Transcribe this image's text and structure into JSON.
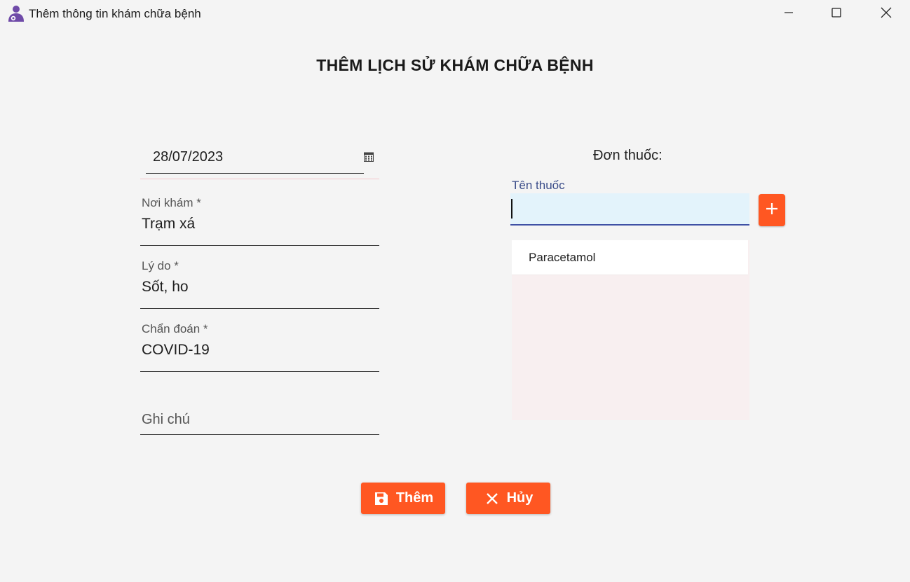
{
  "window": {
    "title": "Thêm thông tin khám chữa bệnh",
    "icon": "user-medical-icon",
    "controls": [
      "minimize-icon",
      "maximize-icon",
      "close-icon"
    ]
  },
  "page": {
    "title": "THÊM LỊCH SỬ KHÁM CHỮA BỆNH"
  },
  "form": {
    "date": {
      "value": "28/07/2023",
      "icon": "calendar-icon"
    },
    "place": {
      "label": "Nơi khám *",
      "value": "Trạm xá"
    },
    "reason": {
      "label": "Lý do *",
      "value": "Sốt, ho"
    },
    "diagnosis": {
      "label": "Chẩn đoán *",
      "value": "COVID-19"
    },
    "note": {
      "placeholder": "Ghi chú",
      "value": ""
    }
  },
  "prescription": {
    "heading": "Đơn thuốc:",
    "drug_input": {
      "label": "Tên thuốc",
      "value": ""
    },
    "add_icon": "plus-icon",
    "drugs": [
      "Paracetamol"
    ]
  },
  "actions": {
    "save": {
      "label": "Thêm",
      "icon": "save-icon"
    },
    "cancel": {
      "label": "Hủy",
      "icon": "close-icon"
    }
  },
  "colors": {
    "accent": "#ff5722",
    "input_focus": "#3f51a5",
    "input_bg": "#e3f3fb",
    "background": "#f4f4f4"
  }
}
